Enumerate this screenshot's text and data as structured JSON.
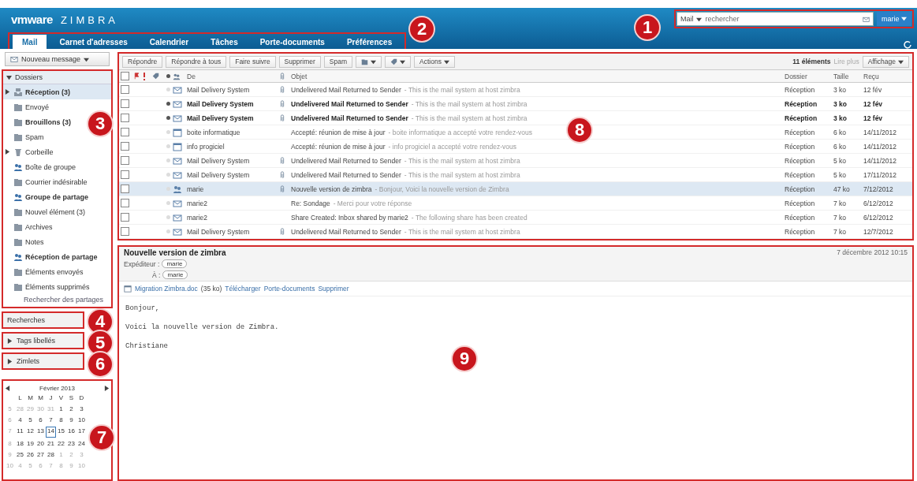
{
  "header": {
    "logo_brand": "vmware",
    "logo_product": "ZIMBRA",
    "search": {
      "scope": "Mail",
      "placeholder": "rechercher"
    },
    "user": "marie"
  },
  "tabs": [
    {
      "label": "Mail",
      "selected": true
    },
    {
      "label": "Carnet d'adresses",
      "selected": false
    },
    {
      "label": "Calendrier",
      "selected": false
    },
    {
      "label": "Tâches",
      "selected": false
    },
    {
      "label": "Porte-documents",
      "selected": false
    },
    {
      "label": "Préférences",
      "selected": false
    }
  ],
  "new_message": "Nouveau message",
  "folders": {
    "title": "Dossiers",
    "expanded": true,
    "items": [
      {
        "label": "Réception (3)",
        "kind": "inbox",
        "unread": true,
        "collapsed": true,
        "selected": true
      },
      {
        "label": "Envoyé",
        "kind": "sent",
        "unread": false,
        "collapsed": false,
        "selected": false
      },
      {
        "label": "Brouillons (3)",
        "kind": "drafts",
        "unread": true,
        "collapsed": false,
        "selected": false
      },
      {
        "label": "Spam",
        "kind": "spam",
        "unread": false,
        "collapsed": false,
        "selected": false
      },
      {
        "label": "Corbeille",
        "kind": "trash",
        "unread": false,
        "collapsed": true,
        "selected": false
      },
      {
        "label": "Boîte de groupe",
        "kind": "shared",
        "unread": false,
        "collapsed": false,
        "selected": false
      },
      {
        "label": "Courrier indésirable",
        "kind": "folder",
        "unread": false,
        "collapsed": false,
        "selected": false
      },
      {
        "label": "Groupe de partage",
        "kind": "shared",
        "unread": true,
        "collapsed": false,
        "selected": false
      },
      {
        "label": "Nouvel élément (3)",
        "kind": "folder",
        "unread": false,
        "collapsed": false,
        "selected": false
      },
      {
        "label": "Archives",
        "kind": "folder",
        "unread": false,
        "collapsed": false,
        "selected": false
      },
      {
        "label": "Notes",
        "kind": "folder",
        "unread": false,
        "collapsed": false,
        "selected": false
      },
      {
        "label": "Réception de partage",
        "kind": "shared",
        "unread": true,
        "collapsed": false,
        "selected": false
      },
      {
        "label": "Éléments envoyés",
        "kind": "folder",
        "unread": false,
        "collapsed": false,
        "selected": false
      },
      {
        "label": "Éléments supprimés",
        "kind": "folder",
        "unread": false,
        "collapsed": false,
        "selected": false
      }
    ],
    "link": "Rechercher des partages"
  },
  "searches": {
    "title": "Recherches"
  },
  "tags": {
    "title": "Tags libellés",
    "expanded": false
  },
  "zimlets": {
    "title": "Zimlets",
    "expanded": false
  },
  "mini_calendar": {
    "month": "Février 2013",
    "weekdays": [
      "L",
      "M",
      "M",
      "J",
      "V",
      "S",
      "D"
    ],
    "weeks": [
      {
        "number": "5",
        "days": [
          {
            "day": "28",
            "other": true,
            "today": false
          },
          {
            "day": "29",
            "other": true,
            "today": false
          },
          {
            "day": "30",
            "other": true,
            "today": false
          },
          {
            "day": "31",
            "other": true,
            "today": false
          },
          {
            "day": "1",
            "other": false,
            "today": false
          },
          {
            "day": "2",
            "other": false,
            "today": false
          },
          {
            "day": "3",
            "other": false,
            "today": false
          }
        ]
      },
      {
        "number": "6",
        "days": [
          {
            "day": "4",
            "other": false,
            "today": false
          },
          {
            "day": "5",
            "other": false,
            "today": false
          },
          {
            "day": "6",
            "other": false,
            "today": false
          },
          {
            "day": "7",
            "other": false,
            "today": false
          },
          {
            "day": "8",
            "other": false,
            "today": false
          },
          {
            "day": "9",
            "other": false,
            "today": false
          },
          {
            "day": "10",
            "other": false,
            "today": false
          }
        ]
      },
      {
        "number": "7",
        "days": [
          {
            "day": "11",
            "other": false,
            "today": false
          },
          {
            "day": "12",
            "other": false,
            "today": false
          },
          {
            "day": "13",
            "other": false,
            "today": false
          },
          {
            "day": "14",
            "other": false,
            "today": true
          },
          {
            "day": "15",
            "other": false,
            "today": false
          },
          {
            "day": "16",
            "other": false,
            "today": false
          },
          {
            "day": "17",
            "other": false,
            "today": false
          }
        ]
      },
      {
        "number": "8",
        "days": [
          {
            "day": "18",
            "other": false,
            "today": false
          },
          {
            "day": "19",
            "other": false,
            "today": false
          },
          {
            "day": "20",
            "other": false,
            "today": false
          },
          {
            "day": "21",
            "other": false,
            "today": false
          },
          {
            "day": "22",
            "other": false,
            "today": false
          },
          {
            "day": "23",
            "other": false,
            "today": false
          },
          {
            "day": "24",
            "other": false,
            "today": false
          }
        ]
      },
      {
        "number": "9",
        "days": [
          {
            "day": "25",
            "other": false,
            "today": false
          },
          {
            "day": "26",
            "other": false,
            "today": false
          },
          {
            "day": "27",
            "other": false,
            "today": false
          },
          {
            "day": "28",
            "other": false,
            "today": false
          },
          {
            "day": "1",
            "other": true,
            "today": false
          },
          {
            "day": "2",
            "other": true,
            "today": false
          },
          {
            "day": "3",
            "other": true,
            "today": false
          }
        ]
      },
      {
        "number": "10",
        "days": [
          {
            "day": "4",
            "other": true,
            "today": false
          },
          {
            "day": "5",
            "other": true,
            "today": false
          },
          {
            "day": "6",
            "other": true,
            "today": false
          },
          {
            "day": "7",
            "other": true,
            "today": false
          },
          {
            "day": "8",
            "other": true,
            "today": false
          },
          {
            "day": "9",
            "other": true,
            "today": false
          },
          {
            "day": "10",
            "other": true,
            "today": false
          }
        ]
      }
    ]
  },
  "toolbar": {
    "buttons": [
      "Répondre",
      "Répondre à tous",
      "Faire suivre",
      "Supprimer",
      "Spam"
    ],
    "actions": "Actions",
    "count": "11 éléments",
    "more": "Lire plus",
    "view": "Affichage"
  },
  "message_list": {
    "select_all_checked": false,
    "columns": [
      "De",
      "Objet",
      "Dossier",
      "Taille",
      "Reçu"
    ],
    "rows": [
      {
        "from": "Mail Delivery System",
        "subject": "Undelivered Mail Returned to Sender",
        "snippet": "- This is the mail system at host zimbra",
        "folder": "Réception",
        "size": "3 ko",
        "date": "12 fév",
        "kind": "mail",
        "unread": false,
        "attachment": true,
        "checked": false,
        "selected": false
      },
      {
        "from": "Mail Delivery System",
        "subject": "Undelivered Mail Returned to Sender",
        "snippet": "- This is the mail system at host zimbra",
        "folder": "Réception",
        "size": "3 ko",
        "date": "12 fév",
        "kind": "mail",
        "unread": true,
        "attachment": true,
        "checked": false,
        "selected": false
      },
      {
        "from": "Mail Delivery System",
        "subject": "Undelivered Mail Returned to Sender",
        "snippet": "- This is the mail system at host zimbra",
        "folder": "Réception",
        "size": "3 ko",
        "date": "12 fév",
        "kind": "mail",
        "unread": true,
        "attachment": true,
        "checked": false,
        "selected": false
      },
      {
        "from": "boite informatique",
        "subject": "Accepté: réunion de mise à jour",
        "snippet": "- boite informatique a accepté votre rendez-vous",
        "folder": "Réception",
        "size": "6 ko",
        "date": "14/11/2012",
        "kind": "calendar",
        "unread": false,
        "attachment": false,
        "checked": false,
        "selected": false
      },
      {
        "from": "info progiciel",
        "subject": "Accepté: réunion de mise à jour",
        "snippet": "- info progiciel a accepté votre rendez-vous",
        "folder": "Réception",
        "size": "6 ko",
        "date": "14/11/2012",
        "kind": "calendar",
        "unread": false,
        "attachment": false,
        "checked": false,
        "selected": false
      },
      {
        "from": "Mail Delivery System",
        "subject": "Undelivered Mail Returned to Sender",
        "snippet": "- This is the mail system at host zimbra",
        "folder": "Réception",
        "size": "5 ko",
        "date": "14/11/2012",
        "kind": "mail",
        "unread": false,
        "attachment": true,
        "checked": false,
        "selected": false
      },
      {
        "from": "Mail Delivery System",
        "subject": "Undelivered Mail Returned to Sender",
        "snippet": "- This is the mail system at host zimbra",
        "folder": "Réception",
        "size": "5 ko",
        "date": "17/11/2012",
        "kind": "mail",
        "unread": false,
        "attachment": true,
        "checked": false,
        "selected": false
      },
      {
        "from": "marie",
        "subject": "Nouvelle version de zimbra",
        "snippet": "- Bonjour, Voici la nouvelle version de Zimbra",
        "folder": "Réception",
        "size": "47 ko",
        "date": "7/12/2012",
        "kind": "contact",
        "unread": false,
        "attachment": true,
        "checked": false,
        "selected": true
      },
      {
        "from": "marie2",
        "subject": "Re: Sondage",
        "snippet": "- Merci pour votre réponse",
        "folder": "Réception",
        "size": "7 ko",
        "date": "6/12/2012",
        "kind": "mail",
        "unread": false,
        "attachment": false,
        "checked": false,
        "selected": false
      },
      {
        "from": "marie2",
        "subject": "Share Created: Inbox shared by marie2",
        "snippet": "- The following share has been created",
        "folder": "Réception",
        "size": "7 ko",
        "date": "6/12/2012",
        "kind": "mail",
        "unread": false,
        "attachment": false,
        "checked": false,
        "selected": false
      },
      {
        "from": "Mail Delivery System",
        "subject": "Undelivered Mail Returned to Sender",
        "snippet": "- This is the mail system at host zimbra",
        "folder": "Réception",
        "size": "7 ko",
        "date": "12/7/2012",
        "kind": "mail",
        "unread": false,
        "attachment": true,
        "checked": false,
        "selected": false
      }
    ]
  },
  "reading_pane": {
    "subject": "Nouvelle version de zimbra",
    "date": "7 décembre 2012 10:15",
    "from_label": "Expéditeur :",
    "from": "marie",
    "to_label": "À :",
    "to": "marie",
    "attachment": {
      "name": "Migration Zimbra.doc",
      "size": "(35 ko)",
      "actions": [
        "Télécharger",
        "Porte-documents",
        "Supprimer"
      ]
    },
    "body": [
      "Bonjour,",
      "Voici la nouvelle version de Zimbra.",
      "Christiane"
    ]
  },
  "annotations": [
    "1",
    "2",
    "3",
    "4",
    "5",
    "6",
    "7",
    "8",
    "9"
  ]
}
